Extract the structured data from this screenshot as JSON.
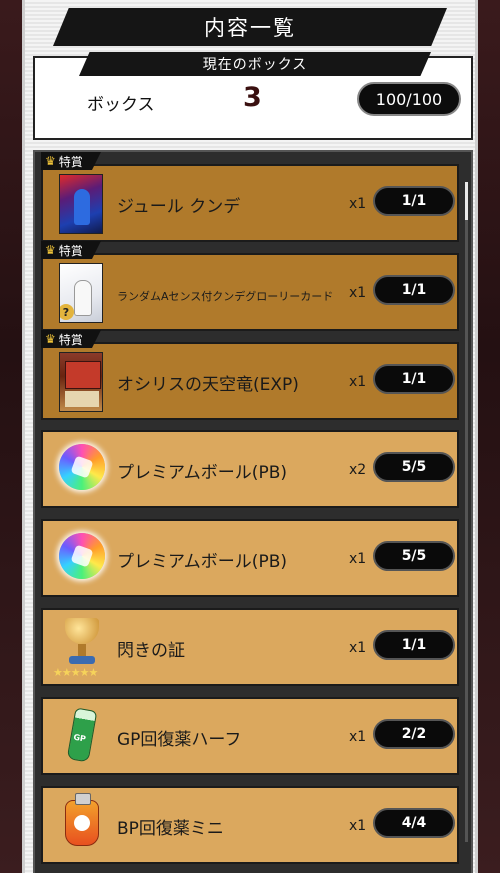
{
  "header": {
    "title": "内容一覧"
  },
  "box": {
    "subtitle": "現在のボックス",
    "label": "ボックス",
    "number": "3",
    "count": "100/100"
  },
  "items": [
    {
      "tag": "特賞",
      "name": "ジュール クンデ",
      "icon": "player-card-icon",
      "multiplier": "x1",
      "count": "1/1",
      "type": "special"
    },
    {
      "tag": "特賞",
      "name": "ランダムAセンス付クンデグローリーカード",
      "icon": "random-player-card-icon",
      "multiplier": "x1",
      "count": "1/1",
      "type": "special"
    },
    {
      "tag": "特賞",
      "name": "オシリスの天空竜(EXP)",
      "icon": "monster-card-icon",
      "multiplier": "x1",
      "count": "1/1",
      "type": "special"
    },
    {
      "name": "プレミアムボール(PB)",
      "icon": "premium-ball-icon",
      "multiplier": "x2",
      "count": "5/5",
      "type": "normal"
    },
    {
      "name": "プレミアムボール(PB)",
      "icon": "premium-ball-icon",
      "multiplier": "x1",
      "count": "5/5",
      "type": "normal"
    },
    {
      "name": "閃きの証",
      "icon": "trophy-icon",
      "stars": "★★★★★",
      "multiplier": "x1",
      "count": "1/1",
      "type": "normal"
    },
    {
      "name": "GP回復薬ハーフ",
      "icon": "gp-bottle-icon",
      "multiplier": "x1",
      "count": "2/2",
      "type": "normal"
    },
    {
      "name": "BP回復薬ミニ",
      "icon": "bp-pouch-icon",
      "multiplier": "x1",
      "count": "4/4",
      "type": "normal"
    }
  ],
  "colors": {
    "special_bg": "#b07a2b",
    "normal_bg": "#dba85e",
    "crown": "#f3c63a"
  }
}
